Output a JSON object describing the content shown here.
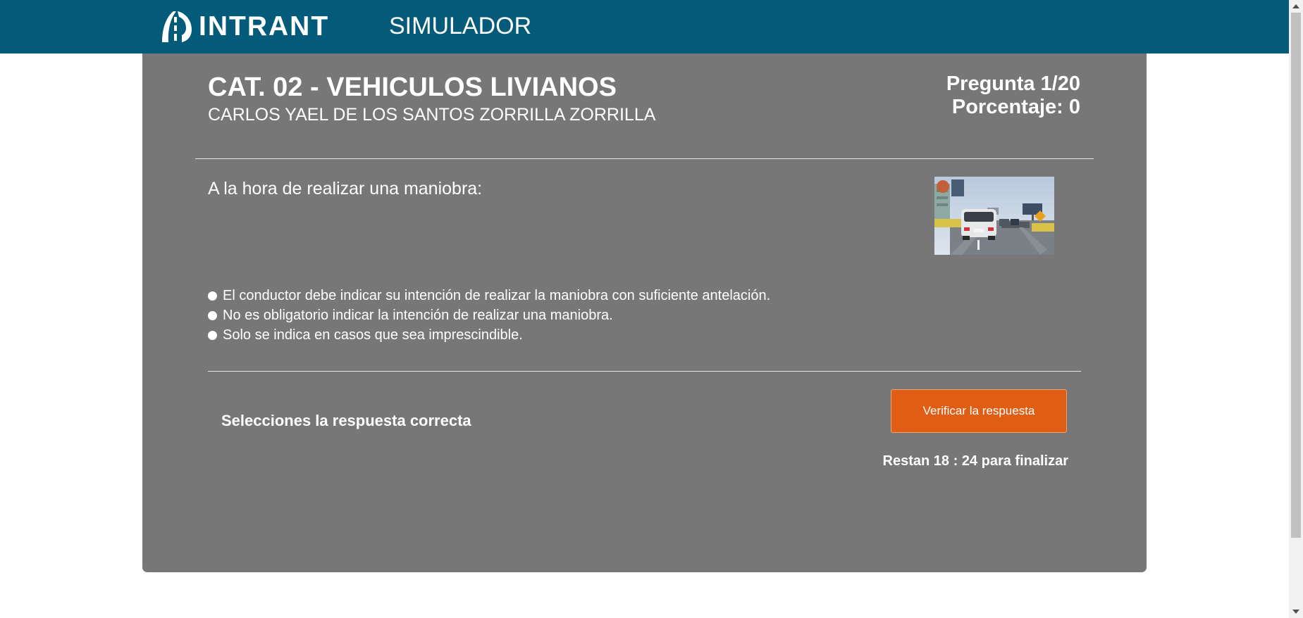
{
  "header": {
    "brand": "INTRANT",
    "nav_label": "SIMULADOR"
  },
  "exam": {
    "category_title": "CAT. 02 - VEHICULOS LIVIANOS",
    "student_name": "CARLOS YAEL DE LOS SANTOS ZORRILLA ZORRILLA",
    "question_counter": "Pregunta 1/20",
    "percentage": "Porcentaje: 0"
  },
  "question": {
    "text": "A la hora de realizar una maniobra:",
    "image_icon": "traffic-photo",
    "options": [
      "El conductor debe indicar su intención de realizar la maniobra con suficiente antelación.",
      "No es obligatorio indicar la intención de realizar una maniobra.",
      "Solo se indica en casos que sea imprescindible."
    ]
  },
  "footer": {
    "instruction": "Selecciones la respuesta correcta",
    "verify_label": "Verificar la respuesta",
    "timer": "Restan 18 : 24 para finalizar"
  },
  "colors": {
    "header_bg": "#035a79",
    "card_bg": "#777777",
    "button_bg": "#e05d14"
  }
}
